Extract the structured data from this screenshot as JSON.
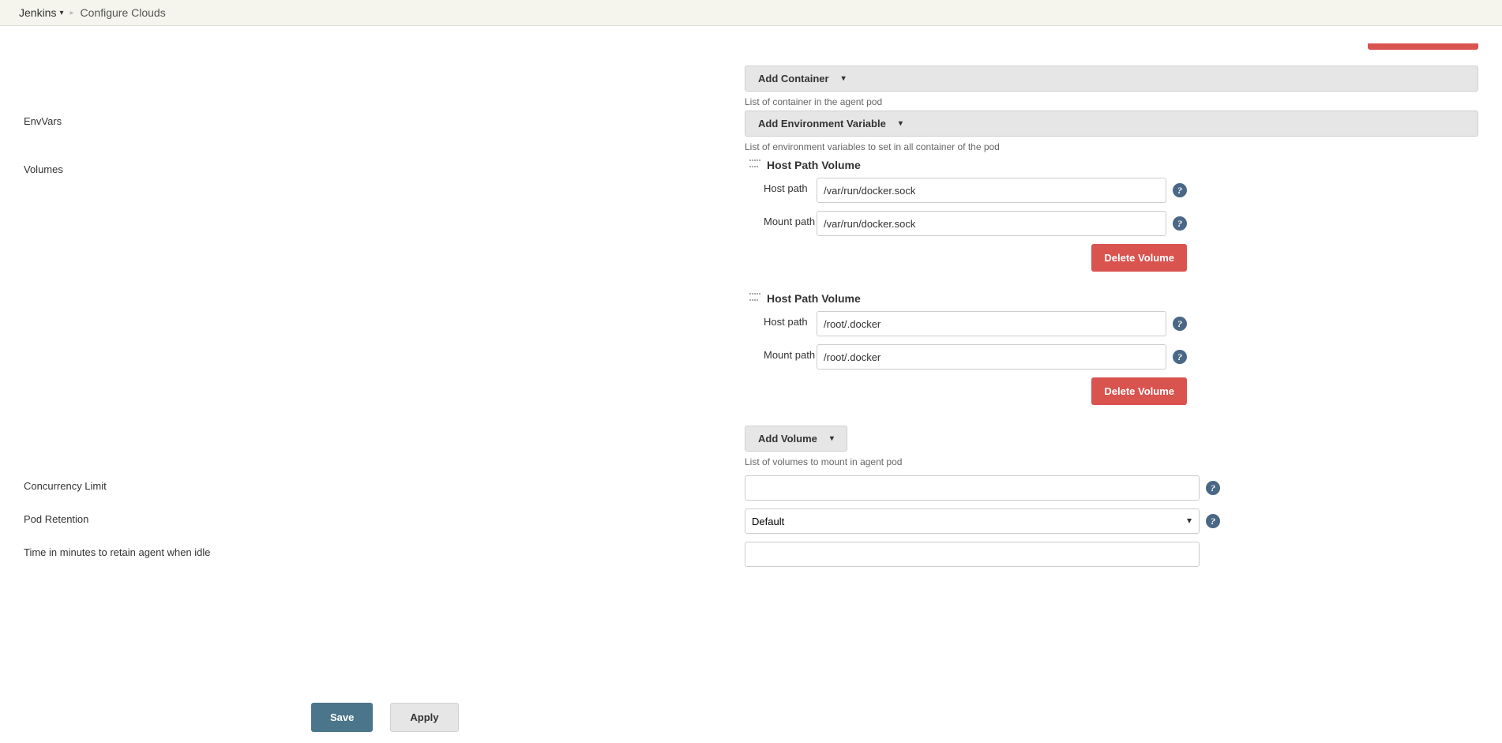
{
  "breadcrumb": {
    "root": "Jenkins",
    "current": "Configure Clouds"
  },
  "dropdowns": {
    "add_container": "Add Container",
    "add_env_var": "Add Environment Variable",
    "add_volume": "Add Volume"
  },
  "helper": {
    "containers": "List of container in the agent pod",
    "envvars": "List of environment variables to set in all container of the pod",
    "volumes": "List of volumes to mount in agent pod"
  },
  "labels": {
    "envvars": "EnvVars",
    "volumes": "Volumes",
    "concurrency": "Concurrency Limit",
    "pod_retention": "Pod Retention",
    "idle_minutes": "Time in minutes to retain agent when idle",
    "host_path": "Host path",
    "mount_path": "Mount path",
    "host_path_volume": "Host Path Volume",
    "delete_volume": "Delete Volume"
  },
  "volumes": [
    {
      "host_path": "/var/run/docker.sock",
      "mount_path": "/var/run/docker.sock"
    },
    {
      "host_path": "/root/.docker",
      "mount_path": "/root/.docker"
    }
  ],
  "fields": {
    "concurrency": "",
    "pod_retention": "Default",
    "idle_minutes": ""
  },
  "buttons": {
    "save": "Save",
    "apply": "Apply"
  }
}
